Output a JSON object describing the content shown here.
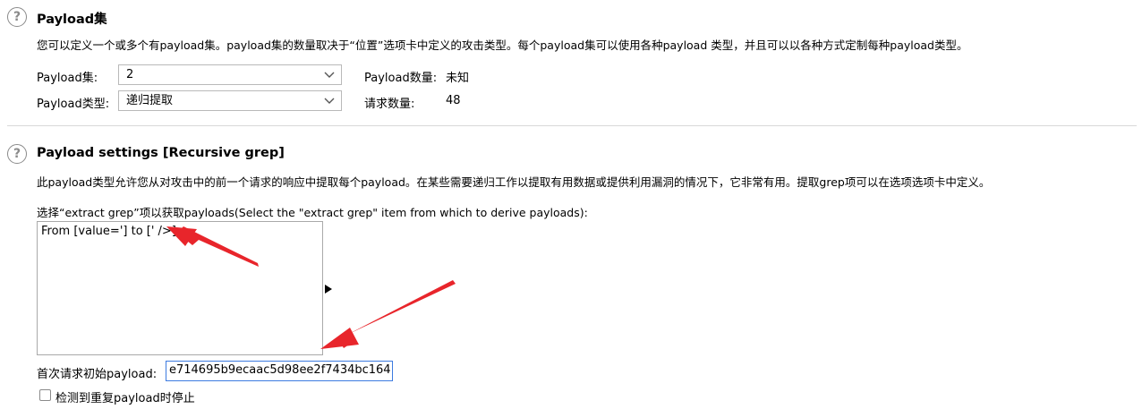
{
  "payload_sets": {
    "title": "Payload集",
    "description": "您可以定义一个或多个有payload集。payload集的数量取决于“位置”选项卡中定义的攻击类型。每个payload集可以使用各种payload 类型，并且可以以各种方式定制每种payload类型。",
    "set_label": "Payload集:",
    "set_value": "2",
    "type_label": "Payload类型:",
    "type_value": "递归提取",
    "count_label": "Payload数量:",
    "count_value": "未知",
    "request_count_label": "请求数量:",
    "request_count_value": "48"
  },
  "payload_settings": {
    "title": "Payload settings [Recursive grep]",
    "description": "此payload类型允许您从对攻击中的前一个请求的响应中提取每个payload。在某些需要递归工作以提取有用数据或提供利用漏洞的情况下，它非常有用。提取grep项可以在选项选项卡中定义。",
    "select_prompt": "选择“extract grep”项以获取payloads(Select the \"extract grep\" item from which to derive payloads):",
    "grep_items": [
      "From [value='] to [' />]"
    ],
    "initial_payload_label": "首次请求初始payload:",
    "initial_payload_value": "e714695b9ecaac5d98ee2f7434bc164",
    "stop_label": "检测到重复payload时停止",
    "stop_checked": false
  },
  "colors": {
    "annotation_arrow": "#e8252b",
    "input_focus": "#3d7be0"
  }
}
